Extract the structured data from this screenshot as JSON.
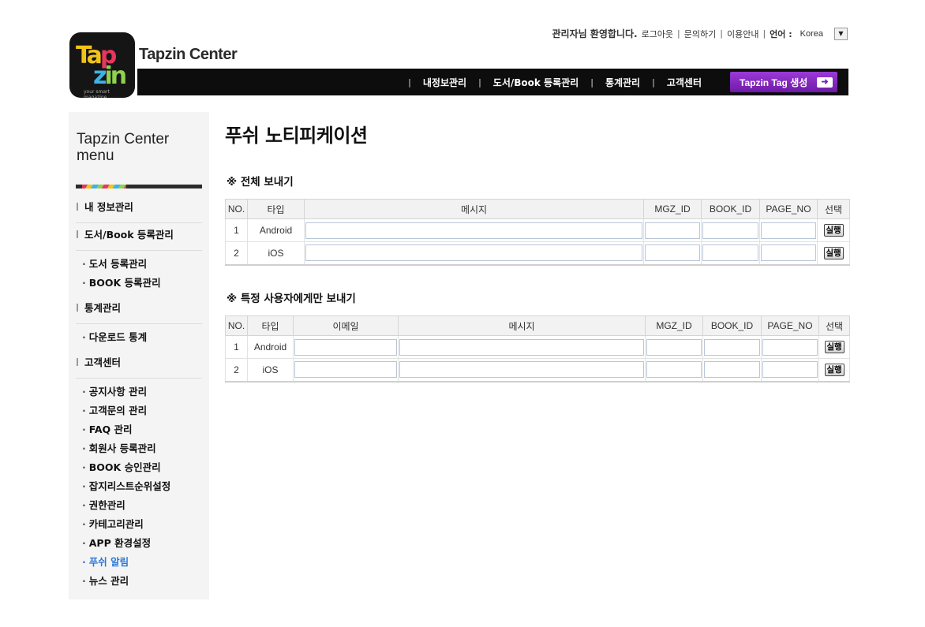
{
  "header": {
    "brand_title": "Tapzin Center",
    "logo": {
      "line1a": "Ta",
      "line1b": "p",
      "line2a": "z",
      "line2b": "in",
      "tagline": "your smart magazine"
    },
    "welcome_name": "관리자",
    "welcome_rest": "님 환영합니다.",
    "links": {
      "logout": "로그아웃",
      "inquiry": "문의하기",
      "guide": "이용안내"
    },
    "language_label": "언어 :",
    "language_value": "Korea",
    "dropdown_icon": "▼",
    "separator": "|"
  },
  "nav": {
    "items": [
      "내정보관리",
      "도서/Book 등록관리",
      "통계관리",
      "고객센터"
    ],
    "tag_button": "Tapzin Tag 생성",
    "tag_arrow": "➜"
  },
  "sidebar": {
    "title": "Tapzin Center menu",
    "sections": [
      {
        "label": "내 정보관리",
        "items": []
      },
      {
        "label": "도서/Book 등록관리",
        "items": [
          "도서 등록관리",
          "BOOK 등록관리"
        ]
      },
      {
        "label": "통계관리",
        "items": [
          "다운로드 통계"
        ]
      },
      {
        "label": "고객센터",
        "items": [
          "공지사항 관리",
          "고객문의 관리",
          "FAQ 관리",
          "회원사 등록관리",
          "BOOK 승인관리",
          "잡지리스트순위설정",
          "권한관리",
          "카테고리관리",
          "APP 환경설정",
          "푸쉬 알림",
          "뉴스 관리"
        ]
      }
    ],
    "active_item": "푸쉬 알림"
  },
  "main": {
    "page_title": "푸쉬 노티피케이션",
    "all": {
      "title": "※ 전체 보내기",
      "columns": [
        "NO.",
        "타입",
        "메시지",
        "MGZ_ID",
        "BOOK_ID",
        "PAGE_NO",
        "선택"
      ],
      "rows": [
        {
          "no": "1",
          "type": "Android",
          "message": "",
          "mgz_id": "",
          "book_id": "",
          "page_no": "",
          "action": "실행"
        },
        {
          "no": "2",
          "type": "iOS",
          "message": "",
          "mgz_id": "",
          "book_id": "",
          "page_no": "",
          "action": "실행"
        }
      ]
    },
    "specific": {
      "title": "※ 특정 사용자에게만 보내기",
      "columns": [
        "NO.",
        "타입",
        "이메일",
        "메시지",
        "MGZ_ID",
        "BOOK_ID",
        "PAGE_NO",
        "선택"
      ],
      "rows": [
        {
          "no": "1",
          "type": "Android",
          "email": "",
          "message": "",
          "mgz_id": "",
          "book_id": "",
          "page_no": "",
          "action": "실행"
        },
        {
          "no": "2",
          "type": "iOS",
          "email": "",
          "message": "",
          "mgz_id": "",
          "book_id": "",
          "page_no": "",
          "action": "실행"
        }
      ]
    }
  },
  "colors": {
    "nav_bg": "#0d0d0d",
    "tag_button": "#7a24b8",
    "active_menu": "#2f78d6",
    "sidebar_bg": "#f4f4f4",
    "input_border": "#b9c6d9"
  }
}
